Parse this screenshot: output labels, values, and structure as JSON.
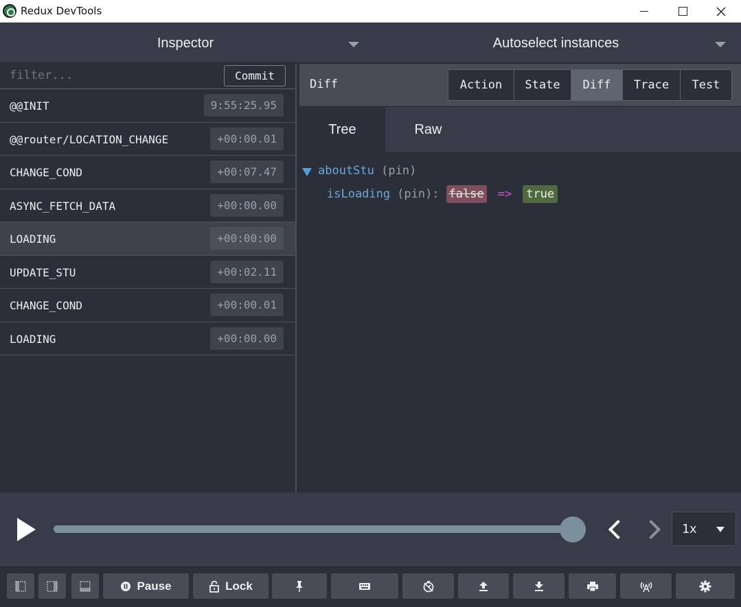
{
  "window": {
    "title": "Redux DevTools"
  },
  "header": {
    "monitor": "Inspector",
    "instances": "Autoselect instances"
  },
  "left": {
    "filter_placeholder": "filter...",
    "commit_label": "Commit",
    "actions": [
      {
        "name": "@@INIT",
        "time": "9:55:25.95"
      },
      {
        "name": "@@router/LOCATION_CHANGE",
        "time": "+00:00.01"
      },
      {
        "name": "CHANGE_COND",
        "time": "+00:07.47"
      },
      {
        "name": "ASYNC_FETCH_DATA",
        "time": "+00:00.00"
      },
      {
        "name": "LOADING",
        "time": "+00:00:00",
        "selected": true
      },
      {
        "name": "UPDATE_STU",
        "time": "+00:02.11"
      },
      {
        "name": "CHANGE_COND",
        "time": "+00:00.01"
      },
      {
        "name": "LOADING",
        "time": "+00:00.00"
      }
    ]
  },
  "right": {
    "label": "Diff",
    "segments": [
      "Action",
      "State",
      "Diff",
      "Trace",
      "Test"
    ],
    "active_segment": "Diff",
    "tabs": [
      "Tree",
      "Raw"
    ],
    "active_tab": "Tree",
    "tree": {
      "root_key": "aboutStu",
      "root_pin": "(pin)",
      "child_key": "isLoading",
      "child_pin": "(pin):",
      "old_value": "false",
      "arrow": "=>",
      "new_value": "true"
    }
  },
  "slider": {
    "speed": "1x",
    "position": 1.0
  },
  "toolbar": {
    "pause_label": "Pause",
    "lock_label": "Lock"
  },
  "colors": {
    "background": "#2a2f3a",
    "panel": "#373c48",
    "key": "#6aa8d8",
    "removed": "#7e4e5c",
    "added": "#4f6a3c",
    "arrow": "#c25ec8",
    "slider": "#7b8f9c"
  }
}
